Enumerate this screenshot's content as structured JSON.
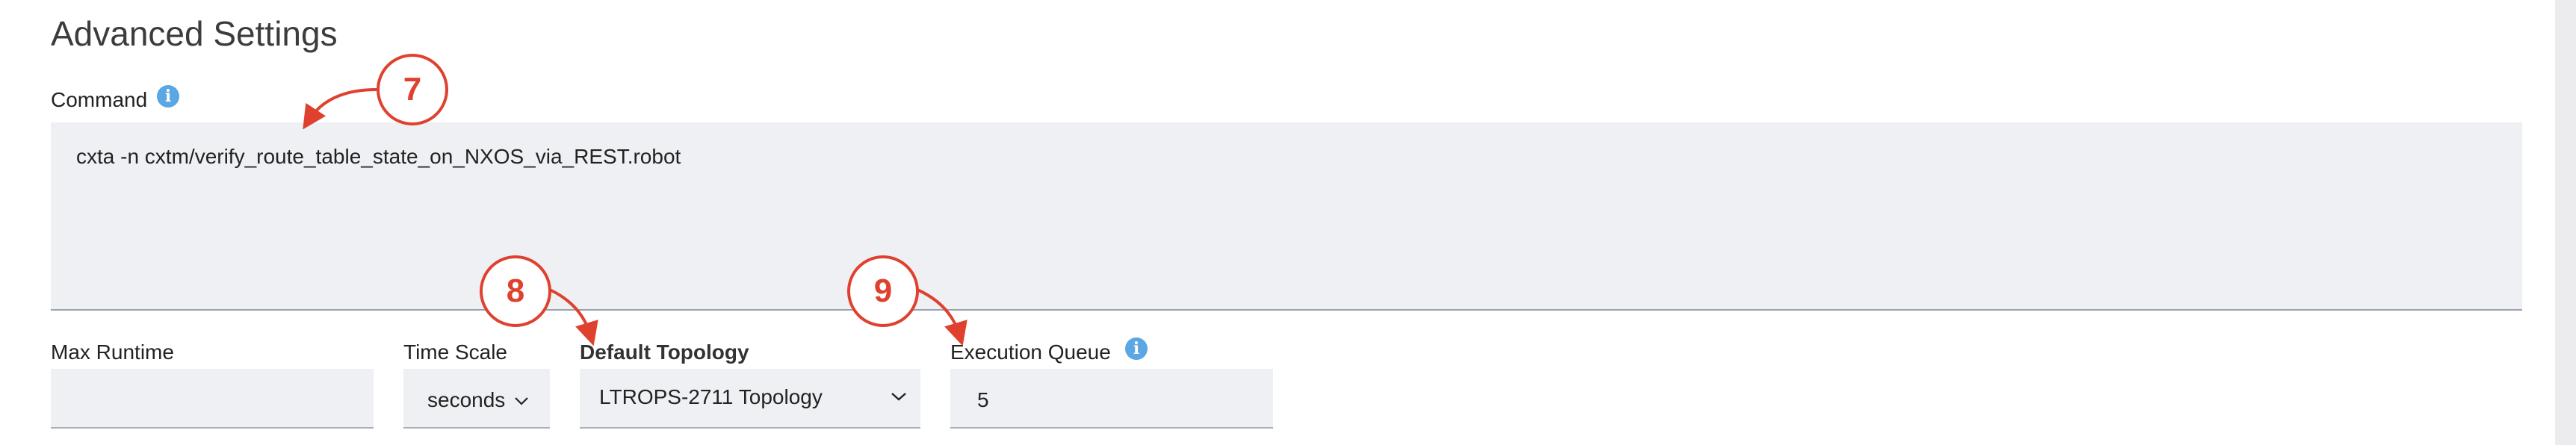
{
  "section": {
    "title": "Advanced Settings"
  },
  "command": {
    "label": "Command",
    "info_icon": "info-icon",
    "value": "cxta -n cxtm/verify_route_table_state_on_NXOS_via_REST.robot"
  },
  "fields": {
    "max_runtime": {
      "label": "Max Runtime",
      "value": ""
    },
    "time_scale": {
      "label": "Time Scale",
      "value": "seconds",
      "icon": "chevron-down-icon"
    },
    "default_topology": {
      "label": "Default Topology",
      "value": "LTROPS-2711 Topology",
      "icon": "chevron-down-icon"
    },
    "execution_queue": {
      "label": "Execution Queue",
      "value": "5",
      "info_icon": "info-icon"
    }
  },
  "callouts": [
    "7",
    "8",
    "9"
  ],
  "colors": {
    "callout": "#e0412f",
    "info": "#5aa7e3",
    "field_bg": "#eef0f3"
  }
}
